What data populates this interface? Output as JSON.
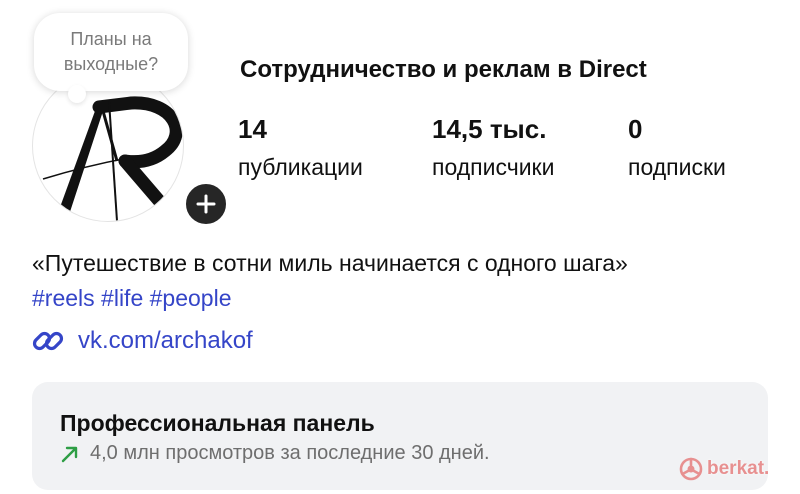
{
  "note": {
    "text": "Планы на выходные?"
  },
  "avatar": {
    "monogram": "AR"
  },
  "profile": {
    "title": "Сотрудничество и реклам в Direct"
  },
  "stats": [
    {
      "value": "14",
      "label": "публикации"
    },
    {
      "value": "14,5 тыс.",
      "label": "подписчики"
    },
    {
      "value": "0",
      "label": "подписки"
    }
  ],
  "bio": {
    "text": "«Путешествие в сотни миль начинается с одного шага»",
    "hashtags": [
      "#reels",
      "#life",
      "#people"
    ]
  },
  "link": {
    "text": "vk.com/archakof",
    "icon": "link-icon"
  },
  "pro_panel": {
    "title": "Профессиональная панель",
    "subtitle": "4,0 млн просмотров за последние 30 дней.",
    "icon": "trend-up-arrow-icon"
  },
  "watermark": {
    "text": "berkat."
  },
  "colors": {
    "link": "#3545c8",
    "trend": "#2e9e45",
    "panel_bg": "#f1f2f4",
    "add_button": "#262626",
    "watermark": "#e67f7f"
  }
}
